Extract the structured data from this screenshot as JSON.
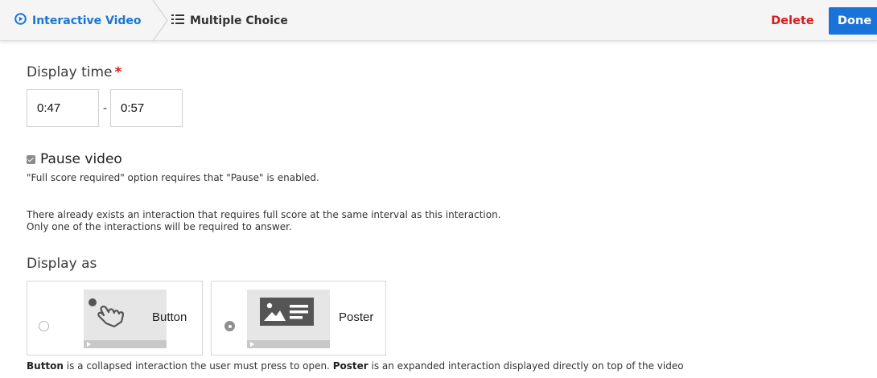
{
  "header": {
    "breadcrumb_first": "Interactive Video",
    "breadcrumb_second": "Multiple Choice",
    "delete_label": "Delete",
    "done_label": "Done",
    "first_icon": "play-circle-icon",
    "second_icon": "list-icon",
    "accent_color": "#1a73d9",
    "delete_color": "#da1a1a"
  },
  "display_time": {
    "label": "Display time",
    "required_marker": "*",
    "start": "0:47",
    "separator": "-",
    "end": "0:57"
  },
  "pause": {
    "checked": true,
    "label": "Pause video",
    "note": "\"Full score required\" option requires that \"Pause\" is enabled.",
    "warning_line1": "There already exists an interaction that requires full score at the same interval as this interaction.",
    "warning_line2": "Only one of the interactions will be required to answer."
  },
  "display_as": {
    "label": "Display as",
    "options": [
      {
        "label": "Button",
        "selected": false,
        "icon": "tap-hand-icon"
      },
      {
        "label": "Poster",
        "selected": true,
        "icon": "poster-icon"
      }
    ],
    "help_button_term": "Button",
    "help_button_text": " is a collapsed interaction the user must press to open. ",
    "help_poster_term": "Poster",
    "help_poster_text": " is an expanded interaction displayed directly on top of the video"
  }
}
